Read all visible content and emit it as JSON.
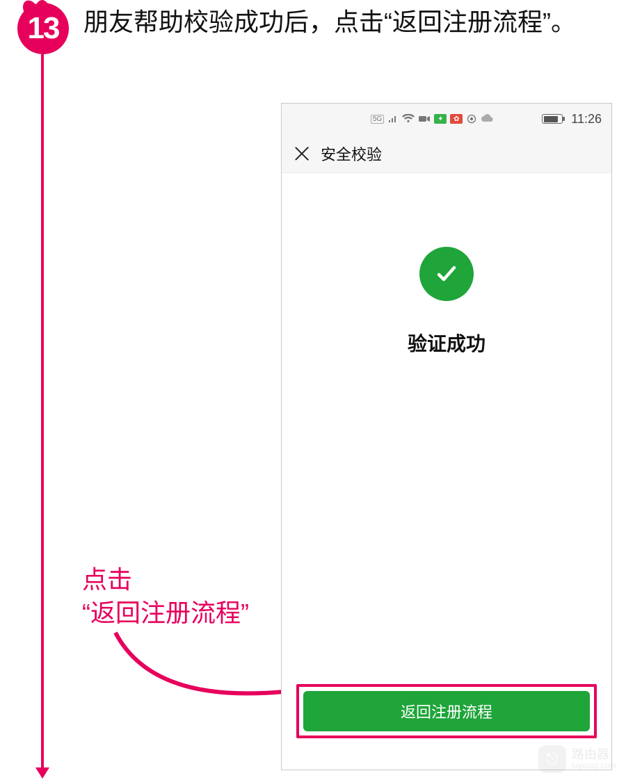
{
  "step": {
    "number": "13"
  },
  "instruction": "朋友帮助校验成功后，点击“返回注册流程”。",
  "annotation": {
    "line1": "点击",
    "line2": "“返回注册流程”"
  },
  "phone": {
    "status": {
      "network_label": "5G",
      "time": "11:26"
    },
    "navbar": {
      "title": "安全校验"
    },
    "content": {
      "success_title": "验证成功",
      "primary_button_label": "返回注册流程"
    }
  },
  "watermark": {
    "title": "路由器",
    "sub": "luyouqi.com"
  },
  "colors": {
    "accent": "#e6005c",
    "primary": "#1fa53a"
  }
}
